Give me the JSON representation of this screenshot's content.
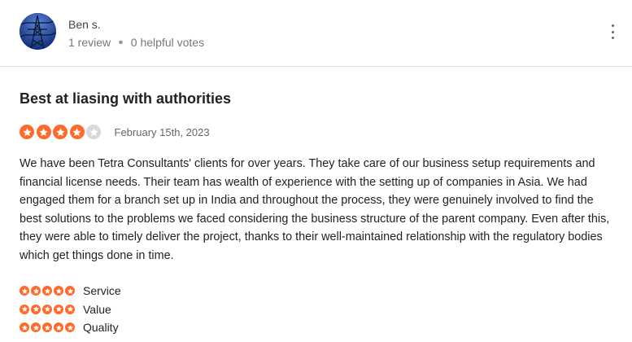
{
  "colors": {
    "star_filled": "#ff6a2b",
    "star_empty": "#d9d9d9",
    "divider": "#dcdcdc"
  },
  "author": {
    "name": "Ben s.",
    "reviews": "1 review",
    "helpful_votes": "0 helpful votes",
    "avatar_icon": "power-tower-photo"
  },
  "menu_icon": "more-vertical-icon",
  "review": {
    "title": "Best at liasing with authorities",
    "rating": 4,
    "rating_max": 5,
    "date": "February 15th, 2023",
    "body": "We have been Tetra Consultants' clients for over years. They take care of our business setup requirements and financial license needs. Their team has wealth of experience with the setting up of companies in Asia. We had engaged them for a branch set up in India and throughout the process, they were genuinely involved to find the best solutions to the problems we faced considering the business structure of the parent company. Even after this, they were able to timely deliver the project, thanks to their well-maintained relationship with the regulatory bodies which get things done in time."
  },
  "sub_ratings": [
    {
      "label": "Service",
      "rating": 5
    },
    {
      "label": "Value",
      "rating": 5
    },
    {
      "label": "Quality",
      "rating": 5
    }
  ]
}
